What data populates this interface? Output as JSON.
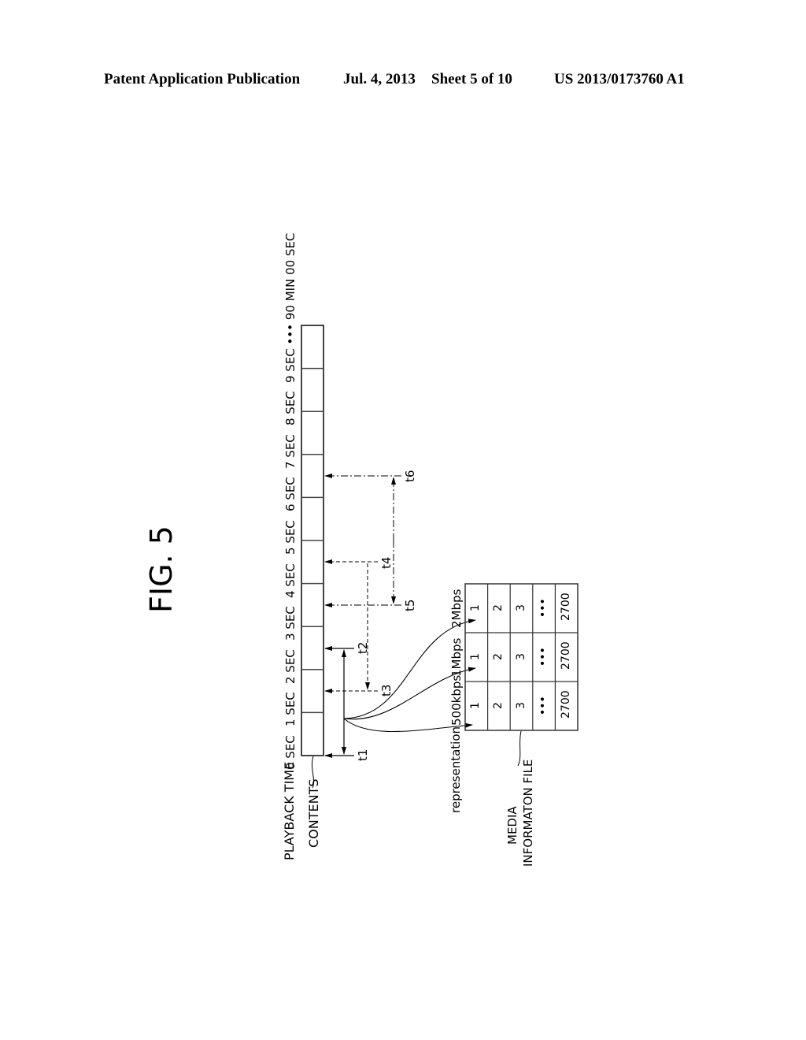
{
  "header": {
    "publication": "Patent Application Publication",
    "date": "Jul. 4, 2013",
    "sheet": "Sheet 5 of 10",
    "number": "US 2013/0173760 A1"
  },
  "figure": {
    "title": "FIG. 5",
    "playback_label": "PLAYBACK TIME",
    "contents_label": "CONTENTS",
    "time_ticks": [
      "0 SEC",
      "1 SEC",
      "2 SEC",
      "3 SEC",
      "4 SEC",
      "5 SEC",
      "6 SEC",
      "7 SEC",
      "8 SEC",
      "9 SEC ••• 90 MIN 00 SEC"
    ],
    "segment_count": 10,
    "timing_labels": [
      "t1",
      "t2",
      "t3",
      "t4",
      "t5",
      "t6"
    ],
    "representation_label": "representation",
    "media_info_label_line1": "MEDIA",
    "media_info_label_line2": "INFORMATON FILE",
    "representations": [
      {
        "bitrate": "500kbps",
        "segments": [
          "1",
          "2",
          "3",
          "•••",
          "2700"
        ]
      },
      {
        "bitrate": "1Mbps",
        "segments": [
          "1",
          "2",
          "3",
          "•••",
          "2700"
        ]
      },
      {
        "bitrate": "2Mbps",
        "segments": [
          "1",
          "2",
          "3",
          "•••",
          "2700"
        ]
      }
    ]
  }
}
